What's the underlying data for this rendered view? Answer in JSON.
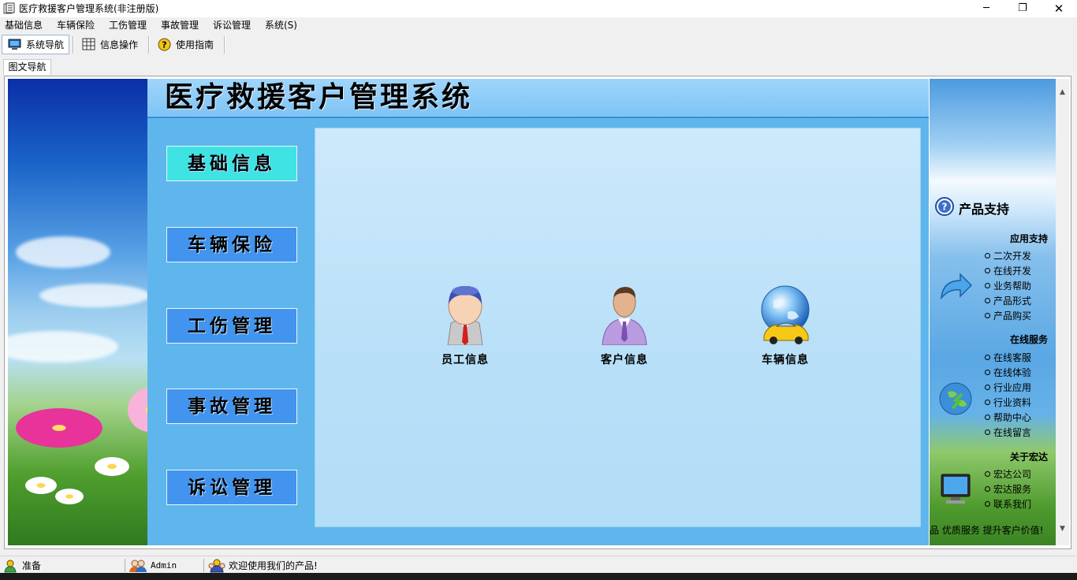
{
  "window": {
    "title": "医疗救援客户管理系统(非注册版)",
    "minimize_glyph": "─",
    "maximize_glyph": "❐",
    "close_glyph": "✕"
  },
  "menubar": {
    "items": [
      "基础信息",
      "车辆保险",
      "工伤管理",
      "事故管理",
      "诉讼管理",
      "系统(S)"
    ]
  },
  "toolbar": {
    "nav_label": "系统导航",
    "ops_label": "信息操作",
    "guide_label": "使用指南",
    "icons": [
      "monitor-icon",
      "grid-icon",
      "help-icon"
    ]
  },
  "tabs": {
    "active": "图文导航"
  },
  "main": {
    "system_title": "医疗救援客户管理系统",
    "nav_buttons": [
      "基础信息",
      "车辆保险",
      "工伤管理",
      "事故管理",
      "诉讼管理"
    ],
    "active_nav": "基础信息",
    "modules": [
      {
        "label": "员工信息",
        "icon": "employee-icon"
      },
      {
        "label": "客户信息",
        "icon": "customer-icon"
      },
      {
        "label": "车辆信息",
        "icon": "vehicle-globe-icon"
      }
    ]
  },
  "right_sidebar": {
    "support_title": "产品支持",
    "sections": [
      {
        "title": "应用支持",
        "links": [
          "二次开发",
          "在线开发",
          "业务帮助",
          "产品形式",
          "产品购买"
        ]
      },
      {
        "title": "在线服务",
        "links": [
          "在线客服",
          "在线体验",
          "行业应用",
          "行业资料",
          "帮助中心",
          "在线留言"
        ]
      },
      {
        "title": "关于宏达",
        "links": [
          "宏达公司",
          "宏达服务",
          "联系我们"
        ]
      }
    ],
    "slogan": "品 优质服务 提升客户价值!"
  },
  "statusbar": {
    "status": "准备",
    "user": "Admin",
    "message": "欢迎使用我们的产品!"
  },
  "colors": {
    "active_nav": "#3fe3e3",
    "nav_button": "#4294ee",
    "center_panel": "#5fb6ec",
    "workspace": "#c4e6fa"
  }
}
